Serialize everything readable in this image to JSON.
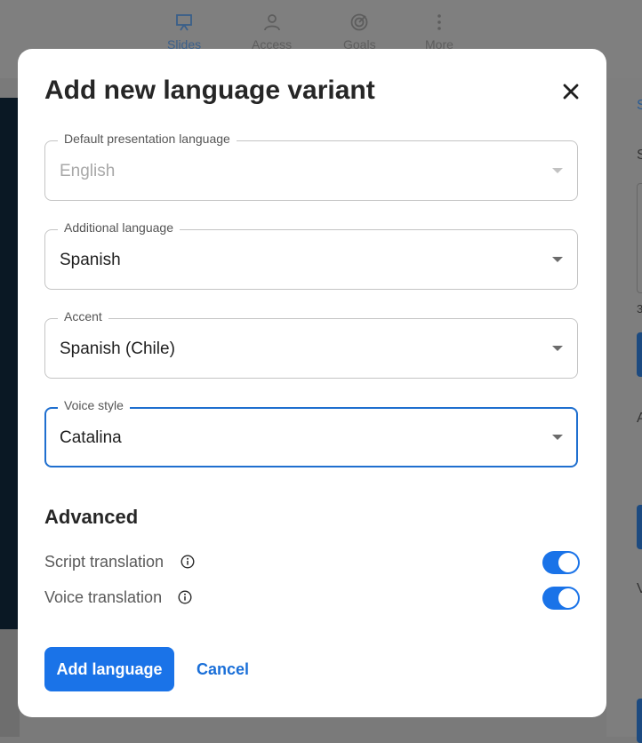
{
  "background": {
    "nav": [
      {
        "label": "Slides",
        "icon": "presentation-icon",
        "active": true
      },
      {
        "label": "Access",
        "icon": "person-icon",
        "active": false
      },
      {
        "label": "Goals",
        "icon": "target-icon",
        "active": false
      },
      {
        "label": "More",
        "icon": "more-vertical-icon",
        "active": false
      }
    ],
    "right_letters": [
      "S",
      "S",
      "3",
      "A",
      "V"
    ]
  },
  "dialog": {
    "title": "Add new language variant",
    "close_icon": "close-icon",
    "fields": {
      "default_language": {
        "label": "Default presentation language",
        "value": "English",
        "disabled": true
      },
      "additional_language": {
        "label": "Additional language",
        "value": "Spanish"
      },
      "accent": {
        "label": "Accent",
        "value": "Spanish (Chile)"
      },
      "voice_style": {
        "label": "Voice style",
        "value": "Catalina",
        "focused": true
      }
    },
    "advanced": {
      "heading": "Advanced",
      "script_translation": {
        "label": "Script translation",
        "enabled": true,
        "icon": "info-icon"
      },
      "voice_translation": {
        "label": "Voice translation",
        "enabled": true,
        "icon": "info-icon"
      }
    },
    "buttons": {
      "add": "Add language",
      "cancel": "Cancel"
    }
  },
  "colors": {
    "accent": "#1a73e8",
    "focus_border": "#1f6fcf"
  }
}
